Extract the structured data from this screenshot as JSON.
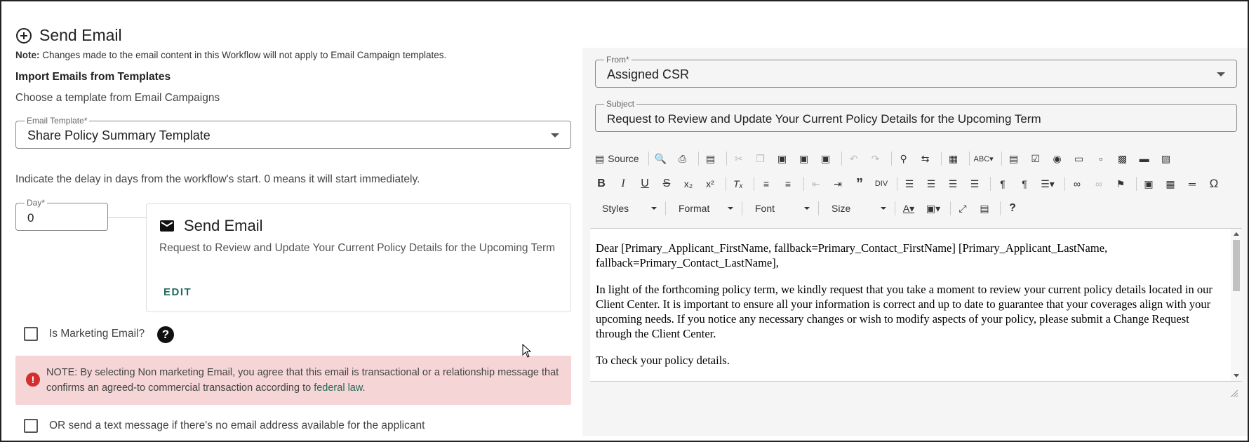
{
  "header": {
    "title": "Send Email"
  },
  "note": {
    "prefix": "Note:",
    "text": " Changes made to the email content in this Workflow will not apply to Email Campaign templates."
  },
  "import": {
    "heading": "Import Emails from Templates",
    "subtext": "Choose a template from Email Campaigns",
    "template_label": "Email Template*",
    "template_value": "Share Policy Summary Template"
  },
  "delay": {
    "text": "Indicate the delay in days from the workflow's start. 0 means it will start immediately.",
    "day_label": "Day*",
    "day_value": "0"
  },
  "card": {
    "title": "Send Email",
    "body": "Request to Review and Update Your Current Policy Details for the Upcoming Term",
    "edit_label": "EDIT"
  },
  "marketing": {
    "label": "Is Marketing Email?",
    "checked": false
  },
  "alert": {
    "text": "NOTE: By selecting Non marketing Email, you agree that this email is transactional or a relationship message that confirms an agreed-to commercial transaction according to ",
    "link": "federal law",
    "suffix": "."
  },
  "sms_option": {
    "label": "OR send a text message if there's no email address available for the applicant",
    "checked": false
  },
  "from": {
    "label": "From*",
    "value": "Assigned CSR"
  },
  "subject": {
    "label": "Subject",
    "value": "Request to Review and Update Your Current Policy Details for the Upcoming Term"
  },
  "toolbar": {
    "source_label": "Source",
    "styles_label": "Styles",
    "format_label": "Format",
    "font_label": "Font",
    "size_label": "Size"
  },
  "editor": {
    "p1": "Dear [Primary_Applicant_FirstName, fallback=Primary_Contact_FirstName] [Primary_Applicant_LastName, fallback=Primary_Contact_LastName],",
    "p2": "In light of the forthcoming policy term, we kindly request that you take a moment to review your current policy details located in our Client Center. It is important to ensure all your information is correct and up to date to guarantee that your coverages align with your upcoming needs. If you notice any necessary changes or wish to modify aspects of your policy, please submit a Change Request through the Client Center.",
    "p3": "To check your policy details."
  },
  "colors": {
    "accent": "#1f6b5c",
    "alert_bg": "#f5d5d5",
    "alert_icon": "#d32f2f"
  }
}
